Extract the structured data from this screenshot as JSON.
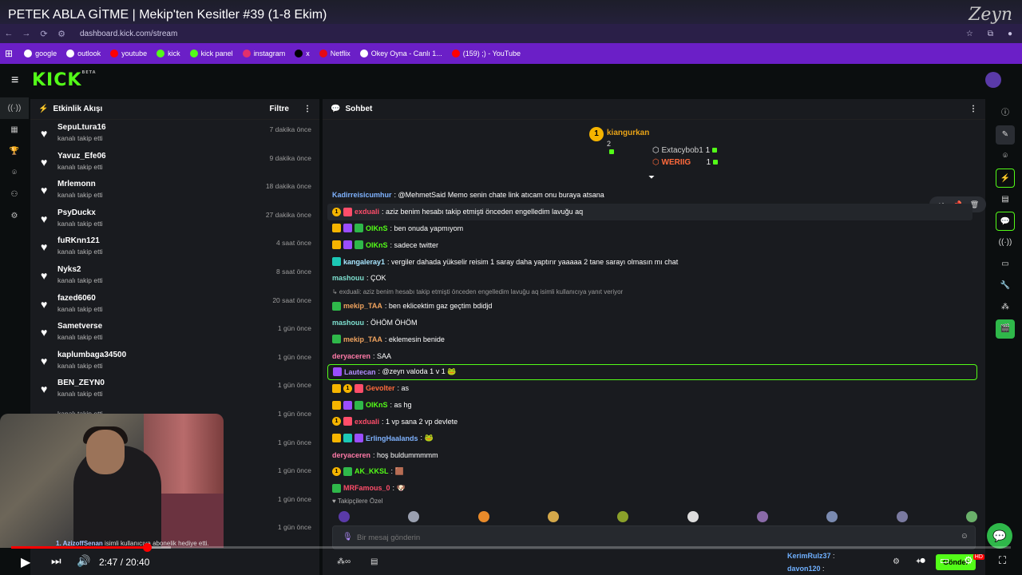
{
  "yt": {
    "title": "PETEK ABLA GİTME | Mekip'ten Kesitler #39 (1-8 Ekim)",
    "channel_logo": "Zeyn"
  },
  "browser": {
    "url": "dashboard.kick.com/stream"
  },
  "bookmarks": [
    {
      "label": "google",
      "color": "#ffffff"
    },
    {
      "label": "outlook",
      "color": "#ffffff"
    },
    {
      "label": "youtube",
      "color": "#ff0000"
    },
    {
      "label": "kick",
      "color": "#53fc18"
    },
    {
      "label": "kick panel",
      "color": "#53fc18"
    },
    {
      "label": "instagram",
      "color": "#e1306c"
    },
    {
      "label": "x",
      "color": "#000000"
    },
    {
      "label": "Netflix",
      "color": "#e50914"
    },
    {
      "label": "Okey Oyna - Canlı 1...",
      "color": "#ffffff"
    },
    {
      "label": "(159) ;) - YouTube",
      "color": "#ff0000"
    }
  ],
  "kick": {
    "logo": "KICK",
    "beta": "BETA"
  },
  "feed": {
    "title": "Etkinlik Akışı",
    "filter_label": "Filtre",
    "sub_text": "kanalı takip etti",
    "items": [
      {
        "name": "SepuLtura16",
        "time": "7 dakika önce"
      },
      {
        "name": "Yavuz_Efe06",
        "time": "9 dakika önce"
      },
      {
        "name": "Mrlemonn",
        "time": "18 dakika önce"
      },
      {
        "name": "PsyDuckx",
        "time": "27 dakika önce"
      },
      {
        "name": "fuRKnn121",
        "time": "4 saat önce"
      },
      {
        "name": "Nyks2",
        "time": "8 saat önce"
      },
      {
        "name": "fazed6060",
        "time": "20 saat önce"
      },
      {
        "name": "Sametverse",
        "time": "1 gün önce"
      },
      {
        "name": "kaplumbaga34500",
        "time": "1 gün önce"
      },
      {
        "name": "BEN_ZEYN0",
        "time": "1 gün önce"
      },
      {
        "name": "",
        "time": "1 gün önce"
      },
      {
        "name": "",
        "time": "1 gün önce"
      },
      {
        "name": "",
        "time": "1 gün önce"
      },
      {
        "name": "",
        "time": "1 gün önce"
      },
      {
        "name": "",
        "time": "1 gün önce"
      }
    ]
  },
  "cam_caption": {
    "user": "1. AzizoffSenan",
    "text": " isimli kullanıcıya abonelik hediye etti."
  },
  "chat": {
    "title": "Sohbet",
    "pinned": {
      "top": {
        "rank": "1",
        "name": "kiangurkan",
        "count": "2"
      },
      "second": {
        "name": "Extacybob1",
        "count": "1"
      },
      "third": {
        "name": "WERIIG",
        "count": "1"
      }
    },
    "messages": [
      {
        "user": "Kadirreisicumhur",
        "color": "#7fb3ff",
        "text": ": @MehmetSaid Memo senin chate link atıcam onu buraya atsana",
        "badges": []
      },
      {
        "user": "exduali",
        "color": "#ff4d6a",
        "text": ": aziz benim hesabı takip etmişti önceden engelledim lavuğu aq",
        "badges": [
          "gold",
          "red"
        ],
        "hl": true
      },
      {
        "user": "OIKnS",
        "color": "#53fc18",
        "text": ": ben onuda yapmıyom",
        "badges": [
          "crown",
          "gift",
          "green"
        ]
      },
      {
        "user": "OIKnS",
        "color": "#53fc18",
        "text": ": sadece twitter",
        "badges": [
          "crown",
          "gift",
          "green"
        ]
      },
      {
        "user": "kangaleray1",
        "color": "#a8e6ff",
        "text": ": vergiler dahada yükselir reisim 1 saray daha yaptırır yaaaaa 2 tane sarayı olmasın mı chat",
        "badges": [
          "teal"
        ]
      },
      {
        "user": "mashouu",
        "color": "#7ee0d0",
        "text": ": ÇOK",
        "badges": []
      },
      {
        "reply": "↳ exduali: aziz benim hesabı takip etmişti önceden engelledim lavuğu aq isimli kullanıcıya yanıt veriyor"
      },
      {
        "user": "mekip_TAA",
        "color": "#f0a35e",
        "text": ": ben eklicektim gaz geçtim bdidjd",
        "badges": [
          "green"
        ]
      },
      {
        "user": "mashouu",
        "color": "#7ee0d0",
        "text": ": ÖHÖM ÖHÖM",
        "badges": []
      },
      {
        "user": "mekip_TAA",
        "color": "#f0a35e",
        "text": ": eklemesin benide",
        "badges": [
          "green"
        ]
      },
      {
        "user": "deryaceren",
        "color": "#ff7aa8",
        "text": ": SAA",
        "badges": []
      },
      {
        "user": "Lautecan",
        "color": "#b28cff",
        "text": ": @zeyn valoda 1 v 1 🐸",
        "badges": [
          "gift"
        ],
        "boxed": true
      },
      {
        "user": "Gevolter",
        "color": "#ff6a3c",
        "text": ": as",
        "badges": [
          "crown",
          "gold",
          "red"
        ]
      },
      {
        "user": "OIKnS",
        "color": "#53fc18",
        "text": ": as hg",
        "badges": [
          "crown",
          "gift",
          "green"
        ]
      },
      {
        "user": "exduali",
        "color": "#ff4d6a",
        "text": ": 1 vp sana 2 vp devlete",
        "badges": [
          "gold",
          "red"
        ]
      },
      {
        "user": "ErlingHaalands",
        "color": "#7fb3ff",
        "text": ": 🐸",
        "badges": [
          "crown",
          "teal",
          "gift"
        ]
      },
      {
        "user": "deryaceren",
        "color": "#ff7aa8",
        "text": ": hoş buldummmmm",
        "badges": []
      },
      {
        "user": "AK_KKSL",
        "color": "#53fc18",
        "text": ": 🟫",
        "badges": [
          "gold",
          "green"
        ]
      },
      {
        "user": "MRFamous_0",
        "color": "#ff4d6a",
        "text": ": 🐶",
        "badges": [
          "green"
        ]
      }
    ],
    "followers_label": "♥ Takipçilere Özel",
    "input_placeholder": "Bir mesaj gönderin",
    "send_label": "Gönder"
  },
  "player": {
    "time": "2:47 / 20:40",
    "progress": 0.1354,
    "buffered": 0.16
  },
  "overlay_chat": [
    {
      "user": "KerimRulz37",
      "sep": " :"
    },
    {
      "user": "davon120",
      "sep": " :"
    }
  ]
}
